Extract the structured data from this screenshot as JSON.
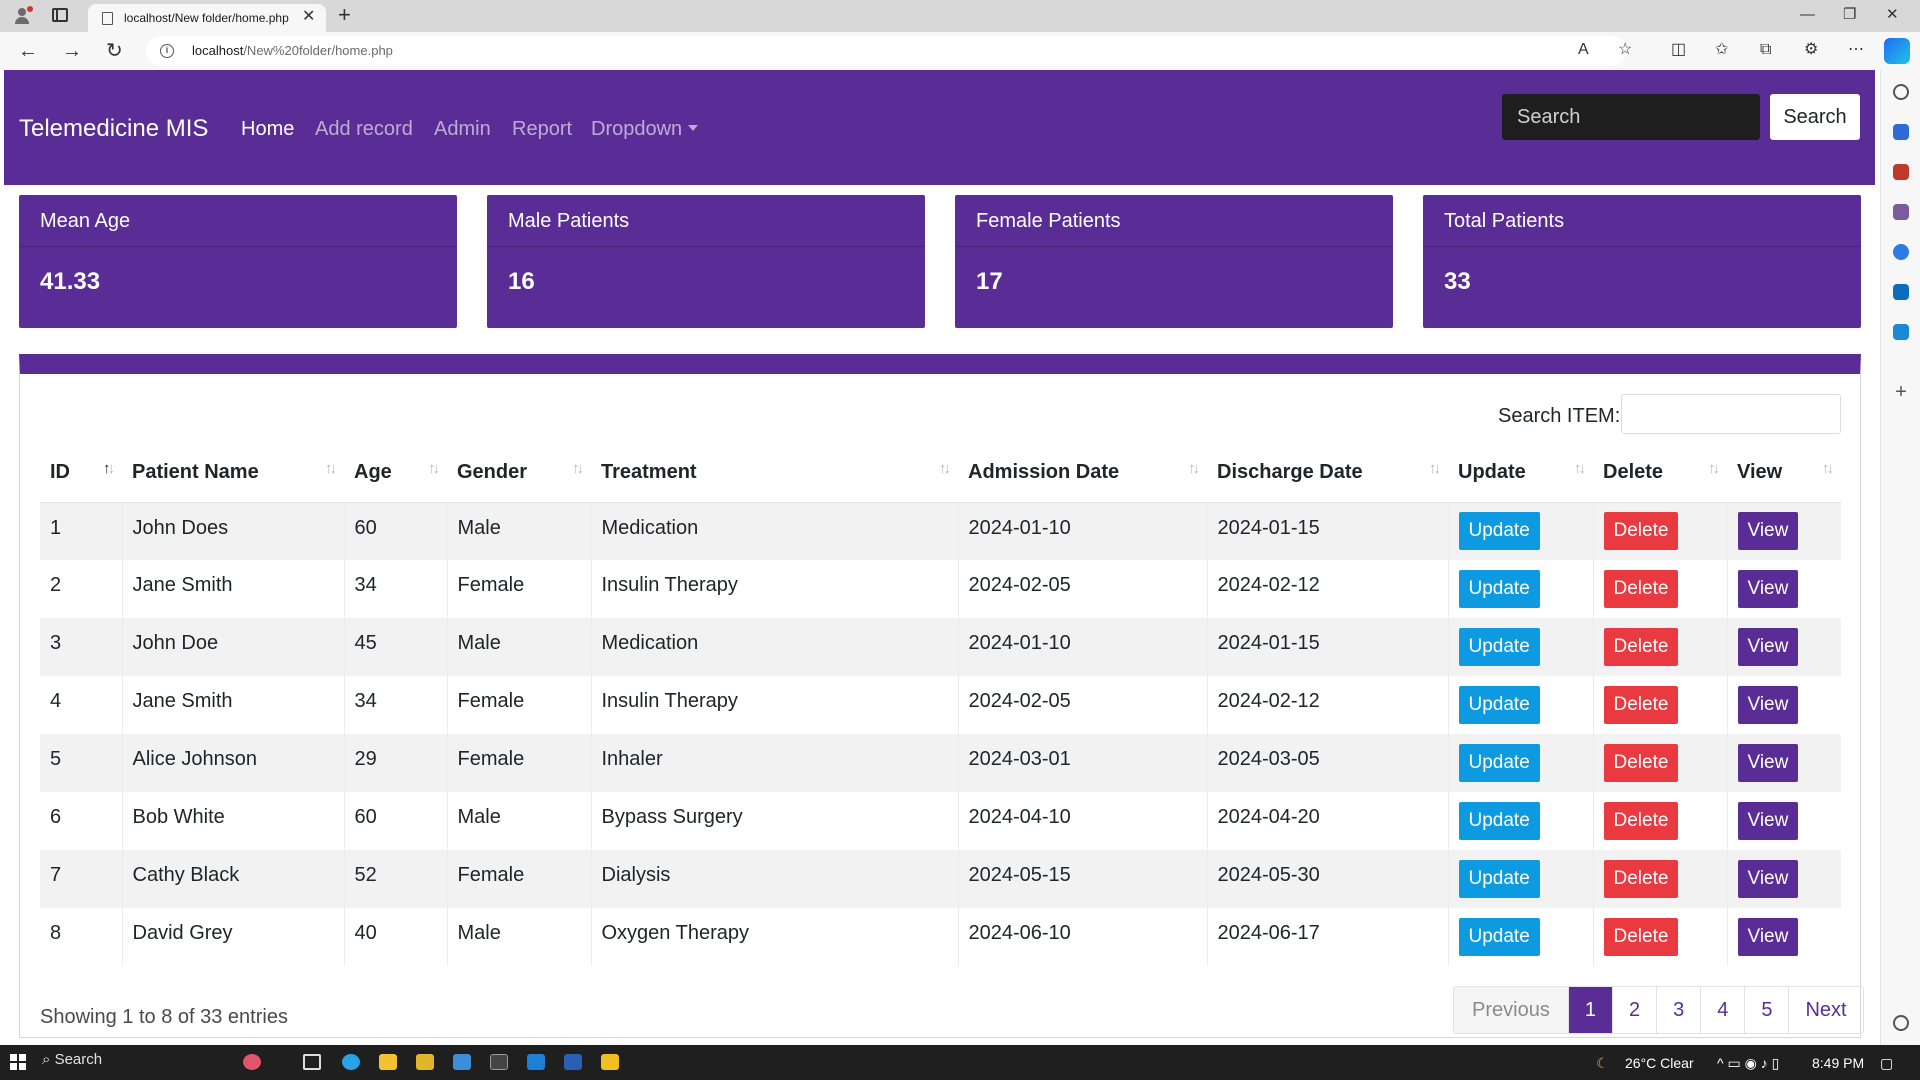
{
  "browser": {
    "tab_title": "localhost/New folder/home.php",
    "url_host": "localhost",
    "url_path": "/New%20folder/home.php"
  },
  "navbar": {
    "brand": "Telemedicine MIS",
    "links": [
      {
        "label": "Home",
        "active": true
      },
      {
        "label": "Add record",
        "active": false
      },
      {
        "label": "Admin",
        "active": false
      },
      {
        "label": "Report",
        "active": false
      },
      {
        "label": "Dropdown",
        "active": false
      }
    ],
    "search_placeholder": "Search",
    "search_button": "Search"
  },
  "stats": [
    {
      "label": "Mean Age",
      "value": "41.33"
    },
    {
      "label": "Male Patients",
      "value": "16"
    },
    {
      "label": "Female Patients",
      "value": "17"
    },
    {
      "label": "Total Patients",
      "value": "33"
    }
  ],
  "table": {
    "search_label": "Search ITEM:",
    "search_value": "",
    "columns": [
      "ID",
      "Patient Name",
      "Age",
      "Gender",
      "Treatment",
      "Admission Date",
      "Discharge Date",
      "Update",
      "Delete",
      "View"
    ],
    "sorted_column": "ID",
    "sort_direction": "asc",
    "rows": [
      {
        "id": "1",
        "name": "John Does",
        "age": "60",
        "gender": "Male",
        "treatment": "Medication",
        "admission": "2024-01-10",
        "discharge": "2024-01-15"
      },
      {
        "id": "2",
        "name": "Jane Smith",
        "age": "34",
        "gender": "Female",
        "treatment": "Insulin Therapy",
        "admission": "2024-02-05",
        "discharge": "2024-02-12"
      },
      {
        "id": "3",
        "name": "John Doe",
        "age": "45",
        "gender": "Male",
        "treatment": "Medication",
        "admission": "2024-01-10",
        "discharge": "2024-01-15"
      },
      {
        "id": "4",
        "name": "Jane Smith",
        "age": "34",
        "gender": "Female",
        "treatment": "Insulin Therapy",
        "admission": "2024-02-05",
        "discharge": "2024-02-12"
      },
      {
        "id": "5",
        "name": "Alice Johnson",
        "age": "29",
        "gender": "Female",
        "treatment": "Inhaler",
        "admission": "2024-03-01",
        "discharge": "2024-03-05"
      },
      {
        "id": "6",
        "name": "Bob White",
        "age": "60",
        "gender": "Male",
        "treatment": "Bypass Surgery",
        "admission": "2024-04-10",
        "discharge": "2024-04-20"
      },
      {
        "id": "7",
        "name": "Cathy Black",
        "age": "52",
        "gender": "Female",
        "treatment": "Dialysis",
        "admission": "2024-05-15",
        "discharge": "2024-05-30"
      },
      {
        "id": "8",
        "name": "David Grey",
        "age": "40",
        "gender": "Male",
        "treatment": "Oxygen Therapy",
        "admission": "2024-06-10",
        "discharge": "2024-06-17"
      }
    ],
    "row_buttons": {
      "update": "Update",
      "delete": "Delete",
      "view": "View"
    },
    "info": "Showing 1 to 8 of 33 entries",
    "pagination": {
      "previous": "Previous",
      "pages": [
        "1",
        "2",
        "3",
        "4",
        "5"
      ],
      "current": "1",
      "next": "Next"
    }
  },
  "taskbar": {
    "search": "Search",
    "weather": "26°C  Clear",
    "time": "8:49 PM"
  },
  "colors": {
    "brand_purple": "#5a2d96",
    "update_blue": "#0d9ae0",
    "delete_red": "#ea3a41"
  }
}
